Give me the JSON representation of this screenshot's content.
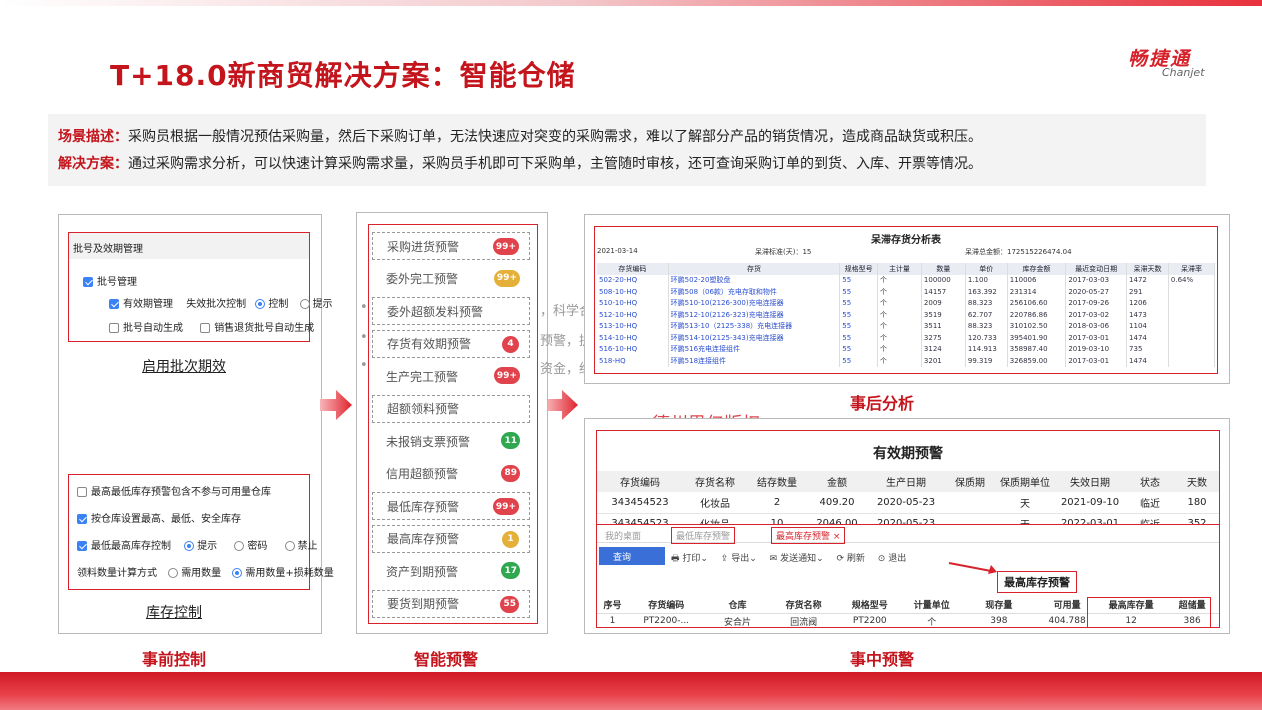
{
  "title": "T+18.0新商贸解决方案：智能仓储",
  "logo": {
    "cn": "畅捷通",
    "en": "Chanjet"
  },
  "description": {
    "scene_label": "场景描述：",
    "scene_text": "采购员根据一般情况预估采购量，然后下采购订单，无法快速应对突变的采购需求，难以了解部分产品的销货情况，造成商品缺货或积压。",
    "solution_label": "解决方案：",
    "solution_text": "通过采购需求分析，可以快速计算采购需求量，采购员手机即可下采购单，主管随时审核，还可查询采购订单的到货、入库、开票等情况。"
  },
  "left_panel": {
    "batch_box_title": "批号及效期管理",
    "batch_mgmt": "批号管理",
    "expiry_mgmt": "有效期管理",
    "expired_batch_ctrl": "失效批次控制",
    "opt_control": "控制",
    "opt_prompt": "提示",
    "auto_gen_batch": "批号自动生成",
    "sales_return_auto": "销售退货批号自动生成",
    "caption_batch": "启用批次期效",
    "stock_opt1": "最高最低库存预警包含不参与可用量仓库",
    "stock_opt2": "按仓库设置最高、最低、安全库存",
    "stock_opt3": "最低最高库存控制",
    "opt3_prompt": "提示",
    "opt3_password": "密码",
    "opt3_forbid": "禁止",
    "stock_opt4": "领料数量计算方式",
    "opt4_a": "需用数量",
    "opt4_b": "需用数量+损耗数量",
    "caption_stock": "库存控制"
  },
  "alerts": [
    {
      "label": "采购进货预警",
      "badge": "99+",
      "color": "#e0434b"
    },
    {
      "label": "委外完工预警",
      "badge": "99+",
      "color": "#e4b03a"
    },
    {
      "label": "委外超额发料预警",
      "badge": "",
      "color": ""
    },
    {
      "label": "存货有效期预警",
      "badge": "4",
      "color": "#e0434b"
    },
    {
      "label": "生产完工预警",
      "badge": "99+",
      "color": "#e0434b"
    },
    {
      "label": "超额领料预警",
      "badge": "",
      "color": ""
    },
    {
      "label": "未报销支票预警",
      "badge": "11",
      "color": "#2fa84f"
    },
    {
      "label": "信用超额预警",
      "badge": "89",
      "color": "#e0434b"
    },
    {
      "label": "最低库存预警",
      "badge": "99+",
      "color": "#e0434b"
    },
    {
      "label": "最高库存预警",
      "badge": "1",
      "color": "#e4b03a"
    },
    {
      "label": "资产到期预警",
      "badge": "17",
      "color": "#2fa84f"
    },
    {
      "label": "要货到期预警",
      "badge": "55",
      "color": "#e0434b"
    }
  ],
  "watermark_lines": [
    "，科学合",
    "预警，提",
    "资金，经"
  ],
  "stagnant": {
    "title": "呆滞存货分析表",
    "date": "2021-03-14",
    "std_label": "呆滞标准(天)：",
    "std_value": "15",
    "total_label": "呆滞总金额：",
    "total_value": "172515226474.04",
    "headers": [
      "存货编码",
      "存货",
      "规格型号",
      "主计量",
      "数量",
      "单价",
      "库存金额",
      "最近变动日期",
      "呆滞天数",
      "呆滞率"
    ],
    "rows": [
      [
        "502-20-HQ",
        "环鹏502-20塑胶盘",
        "55",
        "个",
        "100000",
        "1.100",
        "110006",
        "2017-03-03",
        "1472",
        "0.64%"
      ],
      [
        "508-10-HQ",
        "环鹏508（06款）充电存取和物件",
        "55",
        "个",
        "14157",
        "163.392",
        "231314",
        "2020-05-27",
        "291",
        ""
      ],
      [
        "510-10-HQ",
        "环鹏510-10(2126-300)充电连接器",
        "55",
        "个",
        "2009",
        "88.323",
        "256106.60",
        "2017-09-26",
        "1206",
        ""
      ],
      [
        "512-10-HQ",
        "环鹏512-10(2126-323)充电连接器",
        "55",
        "个",
        "3519",
        "62.707",
        "220786.86",
        "2017-03-02",
        "1473",
        ""
      ],
      [
        "513-10-HQ",
        "环鹏513-10（2125-338）充电连接器",
        "55",
        "个",
        "3511",
        "88.323",
        "310102.50",
        "2018-03-06",
        "1104",
        ""
      ],
      [
        "514-10-HQ",
        "环鹏514-10(2125-343)充电连接器",
        "55",
        "个",
        "3275",
        "120.733",
        "395401.90",
        "2017-03-01",
        "1474",
        ""
      ],
      [
        "516-10-HQ",
        "环鹏516充电连接组件",
        "55",
        "个",
        "3124",
        "114.913",
        "358987.40",
        "2019-03-10",
        "735",
        ""
      ],
      [
        "518-HQ",
        "环鹏518连接组件",
        "55",
        "个",
        "3201",
        "99.319",
        "326859.00",
        "2017-03-01",
        "1474",
        ""
      ]
    ],
    "caption": "事后分析"
  },
  "arrow_up_label": "德州思亿版权",
  "expiry": {
    "title": "有效期预警",
    "headers": [
      "存货编码",
      "存货名称",
      "结存数量",
      "金额",
      "生产日期",
      "保质期",
      "保质期单位",
      "失效日期",
      "状态",
      "天数"
    ],
    "rows": [
      [
        "343454523",
        "化妆品",
        "2",
        "409.20",
        "2020-05-23",
        "",
        "天",
        "2021-09-10",
        "临近",
        "180"
      ],
      [
        "343454523",
        "化妆品",
        "10",
        "2046.00",
        "2020-05-23",
        "",
        "天",
        "2022-03-01",
        "临近",
        "352"
      ]
    ]
  },
  "maxstock": {
    "tabs": [
      "我的桌面",
      "最低库存预警",
      "最高库存预警 ×"
    ],
    "btn_query": "查询",
    "btn_print": "打印",
    "btn_export": "导出",
    "btn_send": "发送通知",
    "btn_refresh": "刷新",
    "btn_exit": "退出",
    "callout": "最高库存预警",
    "headers": [
      "序号",
      "存货编码",
      "仓库",
      "存货名称",
      "规格型号",
      "计量单位",
      "现存量",
      "可用量",
      "最高库存量",
      "超储量"
    ],
    "rows": [
      [
        "1",
        "PT2200-...",
        "安合片",
        "回流阀",
        "PT2200",
        "个",
        "398",
        "404.788",
        "12",
        "386"
      ]
    ]
  },
  "captions": {
    "pre": "事前控制",
    "smart": "智能预警",
    "mid": "事中预警"
  }
}
